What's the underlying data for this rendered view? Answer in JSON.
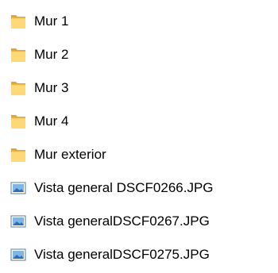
{
  "items": [
    {
      "type": "folder",
      "name": "Mur 1",
      "icon": "folder-icon"
    },
    {
      "type": "folder",
      "name": "Mur 2",
      "icon": "folder-icon"
    },
    {
      "type": "folder",
      "name": "Mur 3",
      "icon": "folder-icon"
    },
    {
      "type": "folder",
      "name": "Mur 4",
      "icon": "folder-icon"
    },
    {
      "type": "folder",
      "name": "Mur exterior",
      "icon": "folder-icon"
    },
    {
      "type": "image",
      "name": "Vista general DSCF0266.JPG",
      "icon": "image-file-icon"
    },
    {
      "type": "image",
      "name": "Vista generalDSCF0267.JPG",
      "icon": "image-file-icon"
    },
    {
      "type": "image",
      "name": "Vista generalDSCF0275.JPG",
      "icon": "image-file-icon"
    }
  ],
  "colors": {
    "folder_fill": "#F5C95A",
    "folder_front": "#FFD978",
    "folder_edge": "#E0A73A",
    "image_border": "#5B7EA0",
    "image_sky": "#7FB6E6",
    "image_ground": "#2F6FB0",
    "text": "#000000"
  }
}
